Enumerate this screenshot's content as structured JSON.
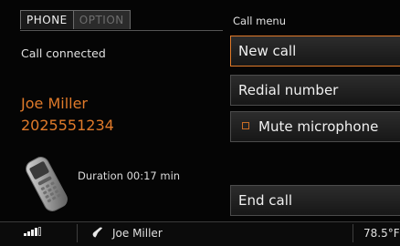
{
  "tabs": [
    {
      "label": "PHONE",
      "active": true
    },
    {
      "label": "OPTION",
      "active": false
    }
  ],
  "call": {
    "status": "Call connected",
    "caller_name": "Joe Miller",
    "caller_number": "2025551234",
    "duration": "Duration 00:17 min"
  },
  "menu": {
    "title": "Call menu",
    "items": [
      {
        "label": "New call",
        "selected": true
      },
      {
        "label": "Redial number",
        "selected": false
      },
      {
        "label": "Mute microphone",
        "checkbox": true,
        "checked": false
      },
      {
        "label": "End call",
        "selected": false
      }
    ]
  },
  "status_bar": {
    "signal_icon": "signal-strength-icon",
    "handset_icon": "handset-icon",
    "active_call_name": "Joe Miller",
    "temperature": "78.5°F"
  },
  "colors": {
    "accent": "#e07a2a",
    "background": "#050505",
    "text": "#e6e6e6"
  }
}
